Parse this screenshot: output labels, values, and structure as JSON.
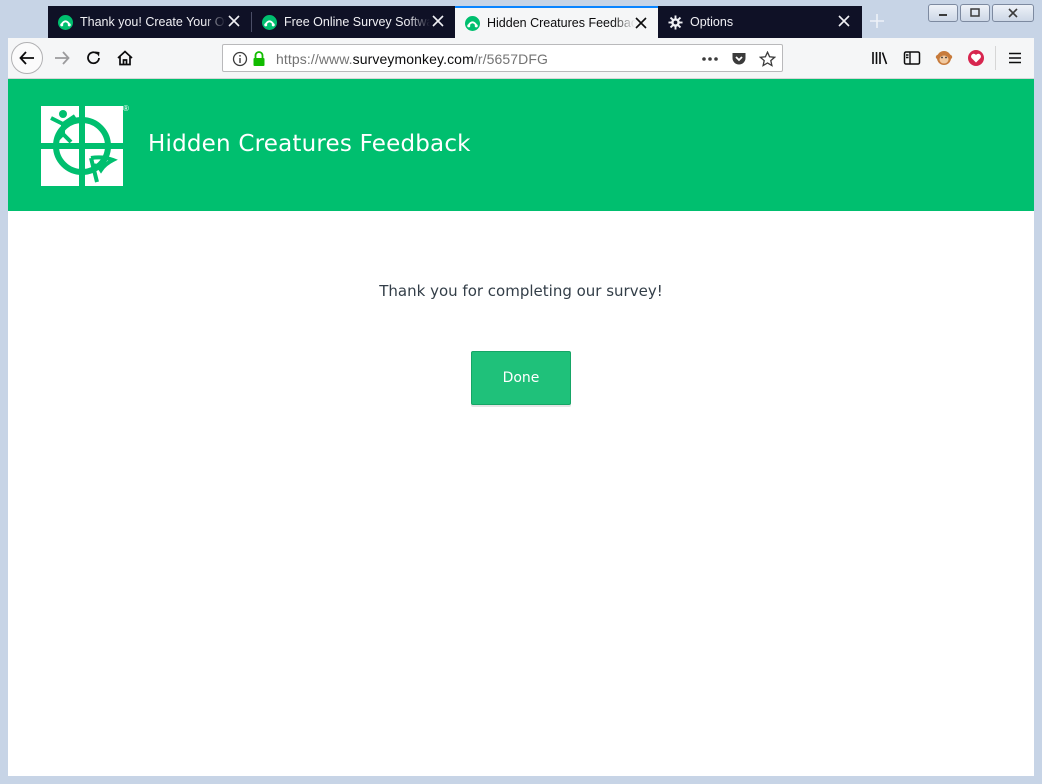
{
  "browser": {
    "tabs": [
      {
        "title": "Thank you! Create Your Own Online Survey",
        "icon": "surveymonkey-icon",
        "active": false
      },
      {
        "title": "Free Online Survey Software and Questionnaire Tool",
        "icon": "surveymonkey-icon",
        "active": false
      },
      {
        "title": "Hidden Creatures Feedback",
        "icon": "surveymonkey-icon",
        "active": true
      },
      {
        "title": "Options",
        "icon": "gear-icon",
        "active": false
      }
    ],
    "url": {
      "scheme": "https://www.",
      "host": "surveymonkey.com",
      "path": "/r/5657DFG"
    },
    "accent": "#0a84ff"
  },
  "page": {
    "banner_color": "#00bf6f",
    "survey_title": "Hidden Creatures Feedback",
    "registered_mark": "®",
    "message": "Thank you for completing our survey!",
    "done_label": "Done",
    "button_color": "#1fc17a"
  }
}
